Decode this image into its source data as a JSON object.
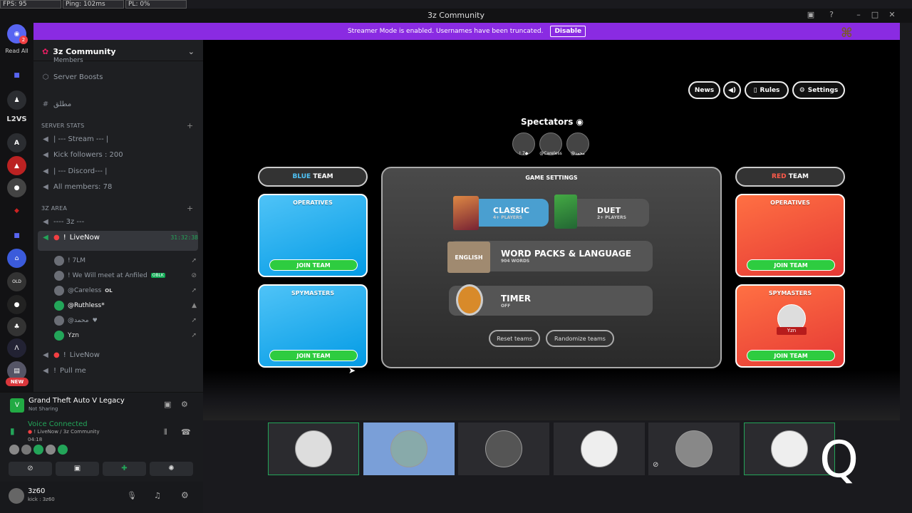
{
  "overlay": {
    "fps": "FPS: 95",
    "ping": "Ping: 102ms",
    "pl": "PL: 0%"
  },
  "window": {
    "title": "3z Community"
  },
  "streamer": {
    "text": "Streamer Mode is enabled. Usernames have been truncated.",
    "button": "Disable"
  },
  "rail": {
    "read_all": "Read All",
    "badge": "2",
    "l2vs": "L2VS",
    "a": "A",
    "new_badge": "NEW"
  },
  "guild": {
    "name": "3z Community"
  },
  "channels": {
    "members": "Members",
    "boosts": "Server Boosts",
    "text1": "مطلق",
    "cat_stats": "SERVER STATS",
    "stream": "| --- Stream --- |",
    "kick": "Kick followers : 200",
    "discord": "| --- Discord--- |",
    "all_members": "All members: 78",
    "cat_area": "3z Area",
    "area_sep": "---- 3z ---",
    "live_now": "LiveNow",
    "live_prefix": "!",
    "live_timer": "31:32:38",
    "voice_users": [
      {
        "name": "! 7LM"
      },
      {
        "name": "! We Will meet at Anfiled",
        "badge": "OBLK"
      },
      {
        "name": "@Careless",
        "badge": "OL"
      },
      {
        "name": "@Ruthless*"
      },
      {
        "name": "@محمد"
      },
      {
        "name": "Yzn"
      }
    ],
    "live_now2": "LiveNow",
    "pull_me": "Pull me"
  },
  "activity": {
    "game": "Grand Theft Auto V Legacy",
    "status": "Not Sharing"
  },
  "voice": {
    "status": "Voice Connected",
    "channel": "! LiveNow / 3z Community",
    "time": "04:18"
  },
  "user": {
    "name": "3z60",
    "status": "kick : 3z60"
  },
  "game": {
    "topbar": {
      "news": "News",
      "rules": "Rules",
      "settings": "Settings"
    },
    "spectators": "Spectators",
    "spectator_names": [
      "! 7◆",
      "@Careless",
      "@محمد"
    ],
    "blue_team": {
      "prefix": "BLUE",
      "suffix": "TEAM"
    },
    "red_team": {
      "prefix": "RED",
      "suffix": "TEAM"
    },
    "operatives": "OPERATIVES",
    "spymasters": "SPYMASTERS",
    "join": "JOIN TEAM",
    "red_spymaster_name": "Yzn",
    "settings_title": "GAME SETTINGS",
    "classic": {
      "label": "CLASSIC",
      "sub": "4+ PLAYERS"
    },
    "duet": {
      "label": "DUET",
      "sub": "2+ PLAYERS"
    },
    "wordpacks": {
      "label": "WORD PACKS & LANGUAGE",
      "sub": "904 WORDS",
      "tag": "ENGLISH"
    },
    "timer": {
      "label": "TIMER",
      "sub": "OFF"
    },
    "reset": "Reset teams",
    "randomize": "Randomize teams"
  },
  "colors": {
    "blurple": "#8a2be2",
    "blue": "#039be5",
    "red": "#e53935",
    "green": "#2ecc40"
  }
}
